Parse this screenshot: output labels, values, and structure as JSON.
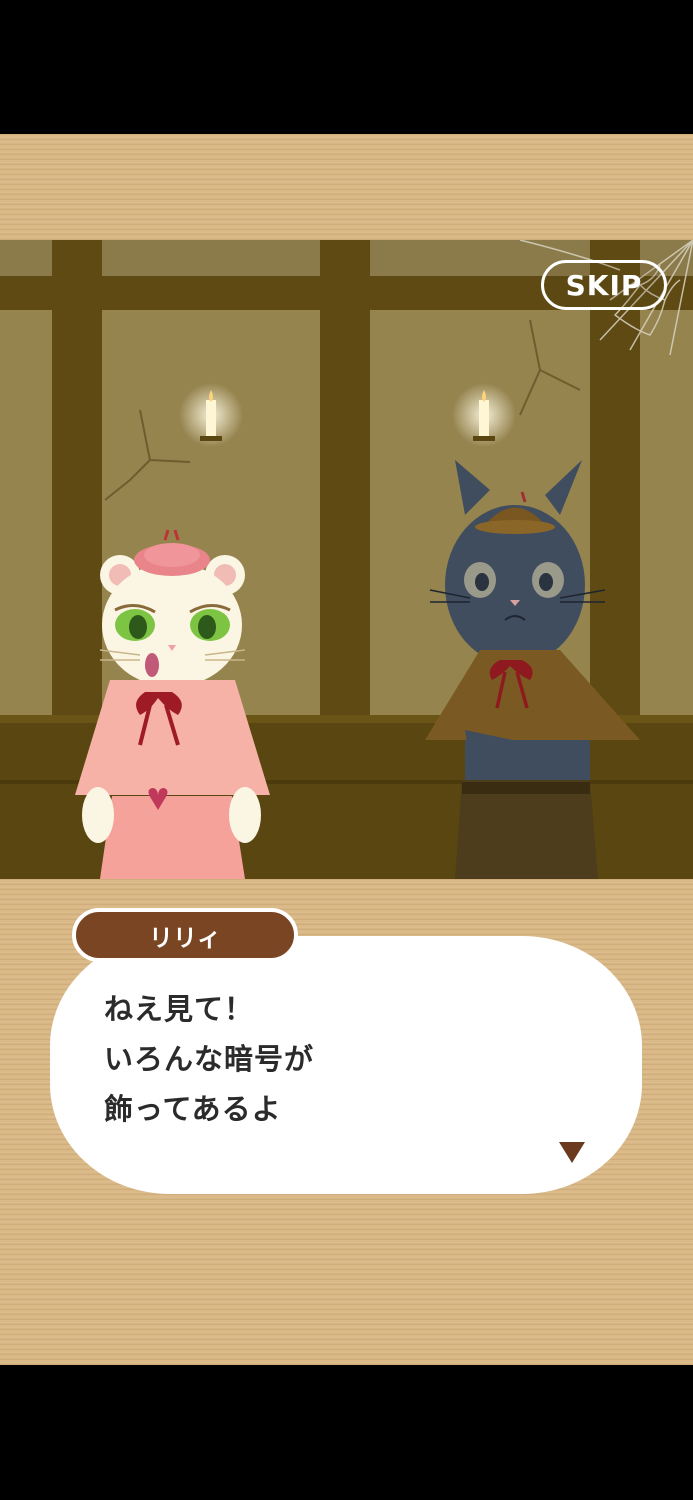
{
  "skip_button": {
    "label": "SKIP"
  },
  "dialogue": {
    "speaker": "リリィ",
    "lines": [
      "ねえ見て！",
      "いろんな暗号が",
      "飾ってあるよ"
    ]
  },
  "icons": {
    "advance": "triangle-down-icon"
  },
  "colors": {
    "cardboard": "#d9b886",
    "wall": "#8c7a48",
    "beam": "#5e4a12",
    "speaker_tag": "#7a4523"
  }
}
